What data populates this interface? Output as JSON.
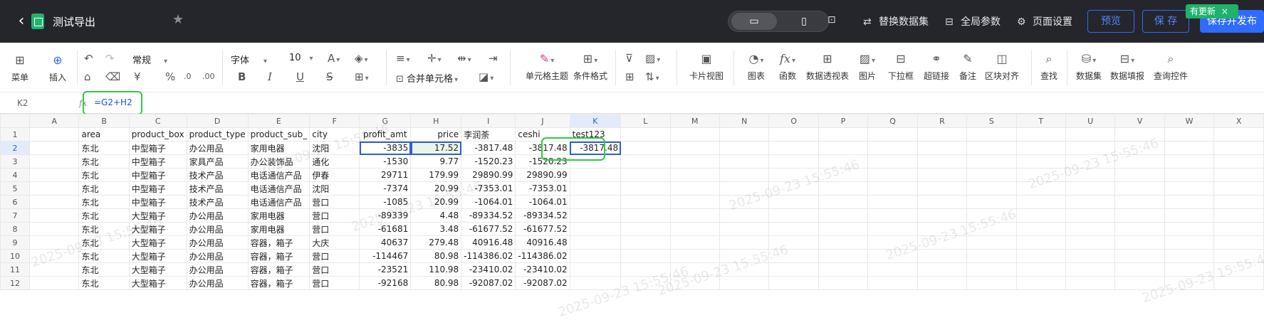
{
  "topbar": {
    "title": "测试导出",
    "actions": {
      "replace_dataset": "替换数据集",
      "global_params": "全局参数",
      "page_settings": "页面设置"
    },
    "preview": "预览",
    "save": "保 存",
    "save_publish": "保存并发布",
    "update_badge": "有更新",
    "update_close": "×"
  },
  "ribbon": {
    "menu": "菜单",
    "insert": "插入",
    "font_style": "常规",
    "font_name": "字体",
    "font_size": "10",
    "merge_cells": "合并单元格",
    "cell_theme": "单元格主题",
    "conditional_format": "条件格式",
    "card_view": "卡片视图",
    "icon": "图表",
    "function": "函数",
    "pivot": "数据透视表",
    "image": "图片",
    "dropdown": "下拉框",
    "hyperlink": "超链接",
    "note": "备注",
    "block_align": "区块对齐",
    "find": "查找",
    "dataset": "数据集",
    "data_fill": "数据填报",
    "query_ctrl": "查询控件"
  },
  "formula_bar": {
    "cell_ref": "K2",
    "fx": "fx",
    "formula": "=G2+H2"
  },
  "sheet": {
    "columns": [
      "A",
      "B",
      "C",
      "D",
      "E",
      "F",
      "G",
      "H",
      "I",
      "J",
      "K",
      "L",
      "M",
      "N",
      "O",
      "P",
      "Q",
      "R",
      "S",
      "T",
      "U",
      "V",
      "W",
      "X"
    ],
    "active_col": "K",
    "active_row": 2,
    "rows": [
      {
        "n": "1",
        "B": "area",
        "C": "product_box",
        "D": "product_type",
        "E": "product_sub_",
        "F": "city",
        "G": "profit_amt",
        "H": "price",
        "I": "李润荼",
        "J": "ceshi",
        "K": "test123"
      },
      {
        "n": "2",
        "B": "东北",
        "C": "中型箱子",
        "D": "办公用品",
        "E": "家用电器",
        "F": "沈阳",
        "G": "-3835",
        "H": "17.52",
        "I": "-3817.48",
        "J": "-3817.48",
        "K": "-3817.48"
      },
      {
        "n": "3",
        "B": "东北",
        "C": "中型箱子",
        "D": "家具产品",
        "E": "办公装饰品",
        "F": "通化",
        "G": "-1530",
        "H": "9.77",
        "I": "-1520.23",
        "J": "-1520.23",
        "K": ""
      },
      {
        "n": "4",
        "B": "东北",
        "C": "中型箱子",
        "D": "技术产品",
        "E": "电话通信产品",
        "F": "伊春",
        "G": "29711",
        "H": "179.99",
        "I": "29890.99",
        "J": "29890.99",
        "K": ""
      },
      {
        "n": "5",
        "B": "东北",
        "C": "中型箱子",
        "D": "技术产品",
        "E": "电话通信产品",
        "F": "沈阳",
        "G": "-7374",
        "H": "20.99",
        "I": "-7353.01",
        "J": "-7353.01",
        "K": ""
      },
      {
        "n": "6",
        "B": "东北",
        "C": "中型箱子",
        "D": "技术产品",
        "E": "电话通信产品",
        "F": "营口",
        "G": "-1085",
        "H": "20.99",
        "I": "-1064.01",
        "J": "-1064.01",
        "K": ""
      },
      {
        "n": "7",
        "B": "东北",
        "C": "大型箱子",
        "D": "办公用品",
        "E": "家用电器",
        "F": "营口",
        "G": "-89339",
        "H": "4.48",
        "I": "-89334.52",
        "J": "-89334.52",
        "K": ""
      },
      {
        "n": "8",
        "B": "东北",
        "C": "大型箱子",
        "D": "办公用品",
        "E": "家用电器",
        "F": "营口",
        "G": "-61681",
        "H": "3.48",
        "I": "-61677.52",
        "J": "-61677.52",
        "K": ""
      },
      {
        "n": "9",
        "B": "东北",
        "C": "大型箱子",
        "D": "办公用品",
        "E": "容器，箱子",
        "F": "大庆",
        "G": "40637",
        "H": "279.48",
        "I": "40916.48",
        "J": "40916.48",
        "K": ""
      },
      {
        "n": "10",
        "B": "东北",
        "C": "大型箱子",
        "D": "办公用品",
        "E": "容器，箱子",
        "F": "营口",
        "G": "-114467",
        "H": "80.98",
        "I": "-114386.02",
        "J": "-114386.02",
        "K": ""
      },
      {
        "n": "11",
        "B": "东北",
        "C": "大型箱子",
        "D": "办公用品",
        "E": "容器，箱子",
        "F": "营口",
        "G": "-23521",
        "H": "110.98",
        "I": "-23410.02",
        "J": "-23410.02",
        "K": ""
      },
      {
        "n": "12",
        "B": "东北",
        "C": "大型箱子",
        "D": "办公用品",
        "E": "容器，箱子",
        "F": "营口",
        "G": "-92168",
        "H": "80.98",
        "I": "-92087.02",
        "J": "-92087.02",
        "K": ""
      }
    ]
  },
  "watermark": "2025-09-23 15:55:46"
}
